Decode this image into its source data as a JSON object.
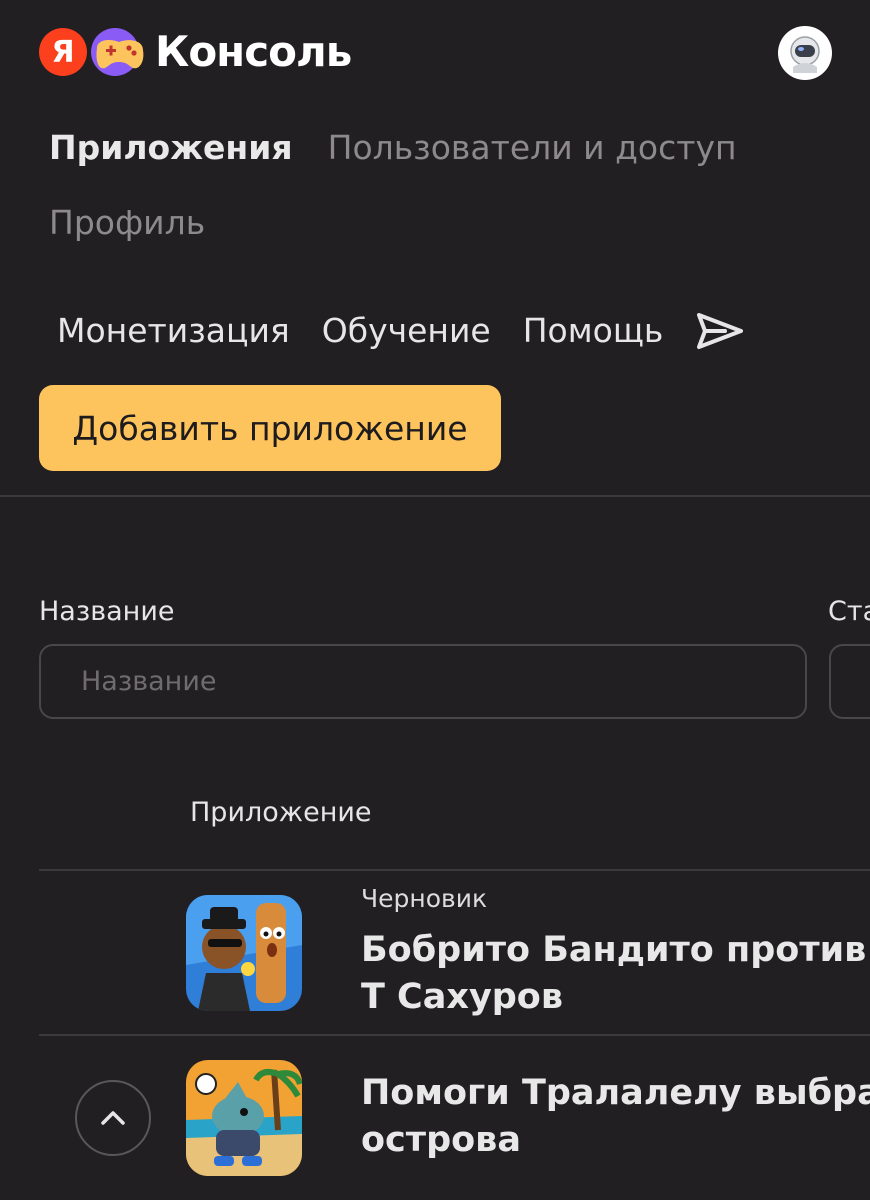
{
  "header": {
    "logo_letter": "Я",
    "brand": "Консоль"
  },
  "nav": {
    "primary": [
      {
        "label": "Приложения",
        "active": true
      },
      {
        "label": "Пользователи и доступ",
        "active": false
      }
    ],
    "profile": "Профиль",
    "secondary": [
      "Монетизация",
      "Обучение",
      "Помощь"
    ]
  },
  "actions": {
    "add_app": "Добавить приложение"
  },
  "filters": {
    "name_label": "Название",
    "name_placeholder": "Название",
    "status_label": "Ста"
  },
  "table": {
    "column_app": "Приложение",
    "rows": [
      {
        "status": "Черновик",
        "title": "Бобрито Бандито против Т Сахуров"
      },
      {
        "status": "",
        "title": "Помоги Тралалелу выбрат острова"
      }
    ]
  },
  "colors": {
    "background": "#221f22",
    "accent": "#fdc35c",
    "yandex_red": "#fc3f1d"
  }
}
